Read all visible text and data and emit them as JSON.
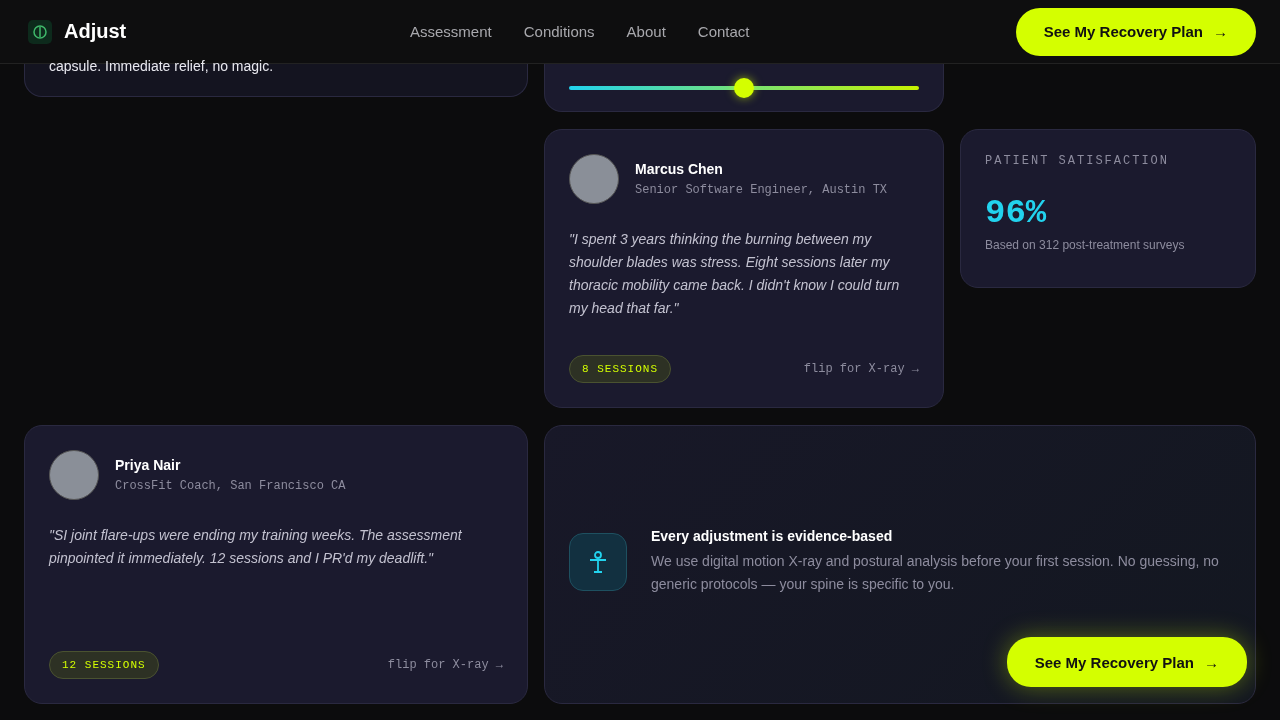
{
  "header": {
    "brand": "Adjust",
    "nav": [
      {
        "label": "Assessment"
      },
      {
        "label": "Conditions"
      },
      {
        "label": "About"
      },
      {
        "label": "Contact"
      }
    ],
    "cta": {
      "label": "See My Recovery Plan",
      "arrow": "→"
    }
  },
  "top_card": {
    "text": "capsule. Immediate relief, no magic."
  },
  "slider_card": {
    "level": 0.5
  },
  "testimonials": [
    {
      "name": "Marcus Chen",
      "role": "Senior Software Engineer, Austin TX",
      "quote": "\"I spent 3 years thinking the burning between my shoulder blades was stress. Eight sessions later my thoracic mobility came back. I didn't know I could turn my head that far.\"",
      "sessions": "8 SESSIONS",
      "flip": "flip for X-ray →"
    },
    {
      "name": "Priya Nair",
      "role": "CrossFit Coach, San Francisco CA",
      "quote": "\"SI joint flare-ups were ending my training weeks. The assessment pinpointed it immediately. 12 sessions and I PR'd my deadlift.\"",
      "sessions": "12 SESSIONS",
      "flip": "flip for X-ray →"
    }
  ],
  "stat": {
    "label": "PATIENT SATISFACTION",
    "value": "96%",
    "note": "Based on 312 post-treatment surveys"
  },
  "feature": {
    "title": "Every adjustment is evidence-based",
    "text": "We use digital motion X-ray and postural analysis before your first session. No guessing, no generic protocols — your spine is specific to you."
  },
  "floating_cta": {
    "label": "See My Recovery Plan",
    "arrow": "→"
  }
}
